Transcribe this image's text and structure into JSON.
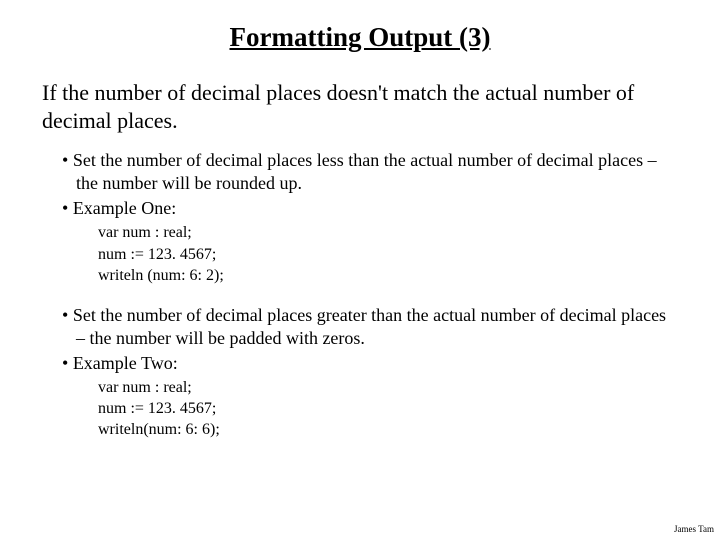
{
  "title": "Formatting Output (3)",
  "intro": "If the number of decimal places doesn't match the actual number of decimal places.",
  "bullets1": {
    "desc": "Set the number of decimal places less than the actual number of decimal places – the number will be rounded up.",
    "exLabel": "Example One:",
    "code": "var num : real;\nnum := 123. 4567;\nwriteln (num: 6: 2);"
  },
  "bullets2": {
    "desc": "Set the number of decimal places greater than the actual number of decimal places – the number will be padded with zeros.",
    "exLabel": "Example Two:",
    "code": "var num : real;\nnum := 123. 4567;\nwriteln(num: 6: 6);"
  },
  "footer": "James Tam"
}
